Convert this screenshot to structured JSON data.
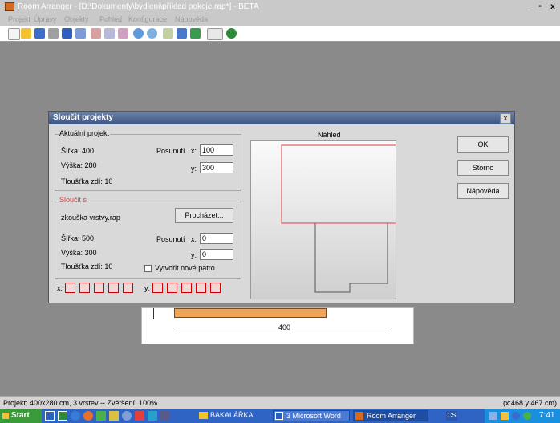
{
  "window": {
    "title": "Room Arranger - [D:\\Dokumenty\\bydleni\\příklad pokoje.rap*] - BETA"
  },
  "menu": [
    "Projekt",
    "Úpravy",
    "Objekty",
    "Pohled",
    "Konfigurace",
    "Nápověda"
  ],
  "plan": {
    "dimension": "400"
  },
  "dialog": {
    "title": "Sloučit projekty",
    "close": "x",
    "current": {
      "legend": "Aktuální projekt",
      "width": "Šířka: 400",
      "height": "Výška: 280",
      "wall": "Tloušťka zdí: 10",
      "offset_label": "Posunutí",
      "x_label": "x:",
      "y_label": "y:",
      "x_value": "100",
      "y_value": "300"
    },
    "merge": {
      "legend": "Sloučit s",
      "file": "zkouška vrstvy.rap",
      "browse": "Procházet...",
      "width": "Šířka: 500",
      "height": "Výška: 300",
      "wall": "Tloušťka zdí: 10",
      "offset_label": "Posunutí",
      "x_label": "x:",
      "y_label": "y:",
      "x_value": "0",
      "y_value": "0",
      "new_floor": "Vytvořit nové patro"
    },
    "align": {
      "x_label": "x:",
      "y_label": "y:"
    },
    "preview_label": "Náhled",
    "ok": "OK",
    "cancel": "Storno",
    "help": "Nápověda"
  },
  "status": {
    "left": "Projekt: 400x280 cm, 3 vrstev -- Zvětšení: 100%",
    "right": "(x:468 y:467 cm)"
  },
  "taskbar": {
    "start": "Start",
    "folder": "BAKALÁŘKA",
    "word": "3 Microsoft Word",
    "app": "Room Arranger",
    "lang": "CS",
    "time": "7:41"
  },
  "colors": {
    "accent_red": "#e04040",
    "dialog_bg": "#d9d9d9",
    "taskbar": "#2f64c4"
  }
}
